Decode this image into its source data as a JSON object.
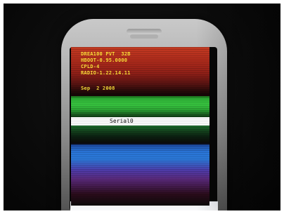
{
  "screen": {
    "boot_info": {
      "line1": "DREA100 PVT  32B",
      "line2": "HBOOT-0.95.0000",
      "line3": "CPLD-4",
      "line4": "RADIO-1.22.14.11",
      "date": "Sep  2 2008"
    },
    "serial_label": "Serial0",
    "colors": {
      "top_band": "#c23a22",
      "green_band": "#38c640",
      "blue_band": "#2b78d8",
      "text_yellow": "#ffe23a"
    }
  }
}
